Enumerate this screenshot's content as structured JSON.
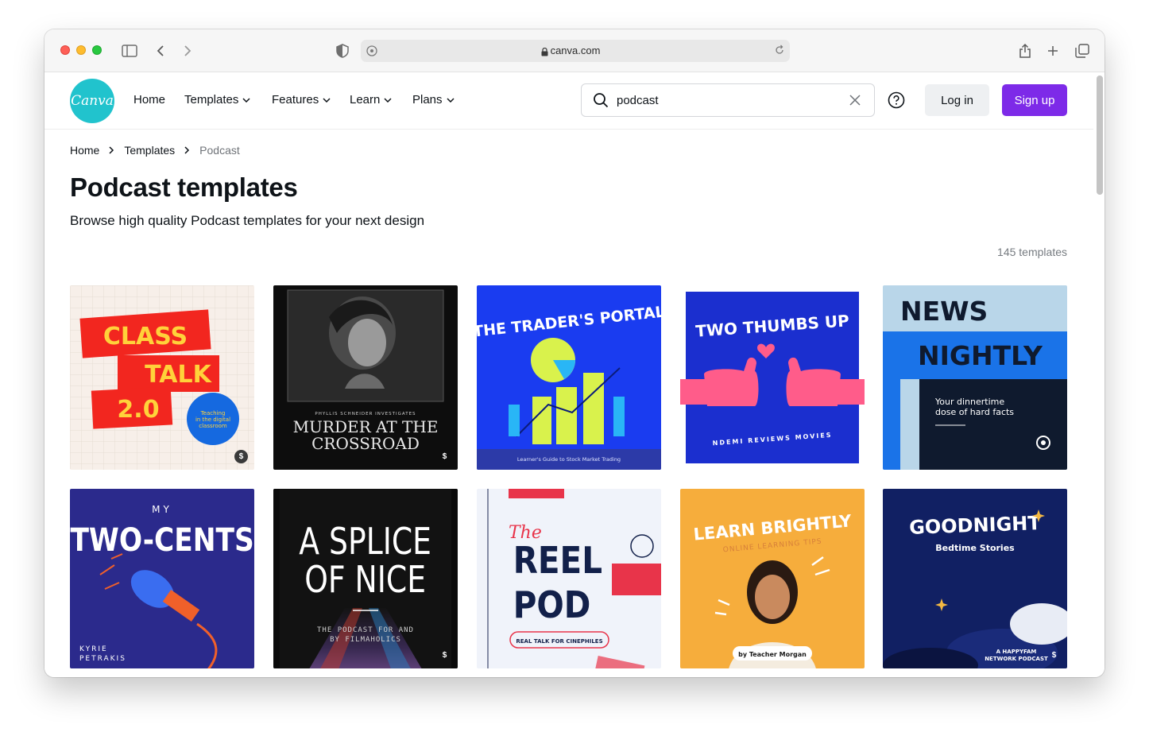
{
  "browser": {
    "url": "canva.com"
  },
  "brand": {
    "logo_text": "Canva"
  },
  "nav": {
    "items": [
      {
        "label": "Home"
      },
      {
        "label": "Templates"
      },
      {
        "label": "Features"
      },
      {
        "label": "Learn"
      },
      {
        "label": "Plans"
      }
    ],
    "search_value": "podcast",
    "login_label": "Log in",
    "signup_label": "Sign up"
  },
  "breadcrumb": [
    "Home",
    "Templates",
    "Podcast"
  ],
  "page": {
    "title": "Podcast templates",
    "subtitle": "Browse high quality Podcast templates for your next design",
    "count": "145 templates"
  },
  "templates": [
    {
      "lines": [
        "CLASS",
        "TALK",
        "2.0"
      ],
      "extra": [
        "Teaching",
        "in the digital",
        "classroom"
      ],
      "badge": "$"
    },
    {
      "lines": [
        "PHYLLIS SCHNEIDER INVESTIGATES",
        "MURDER AT THE",
        "CROSSROAD"
      ],
      "badge": "$"
    },
    {
      "lines": [
        "THE TRADER'S PORTAL",
        "Learner's Guide to Stock Market Trading"
      ]
    },
    {
      "lines": [
        "TWO THUMBS UP",
        "NDEMI REVIEWS MOVIES"
      ]
    },
    {
      "lines": [
        "NEWS",
        "NIGHTLY",
        "Your dinnertime",
        "dose of hard facts"
      ]
    },
    {
      "lines": [
        "MY",
        "TWO-CENTS",
        "KYRIE",
        "PETRAKIS"
      ]
    },
    {
      "lines": [
        "A SPLICE",
        "OF NICE",
        "THE PODCAST FOR AND",
        "BY FILMAHOLICS"
      ],
      "badge": "$"
    },
    {
      "lines": [
        "The",
        "REEL",
        "POD",
        "REAL TALK FOR CINEPHILES"
      ]
    },
    {
      "lines": [
        "LEARN BRIGHTLY",
        "ONLINE LEARNING TIPS",
        "by Teacher Morgan"
      ]
    },
    {
      "lines": [
        "GOODNIGHT",
        "Bedtime Stories",
        "A HAPPYFAM",
        "NETWORK PODCAST"
      ],
      "badge": "$"
    }
  ],
  "colors": {
    "accent": "#7d2ae8",
    "logo": "#21c3cd"
  }
}
